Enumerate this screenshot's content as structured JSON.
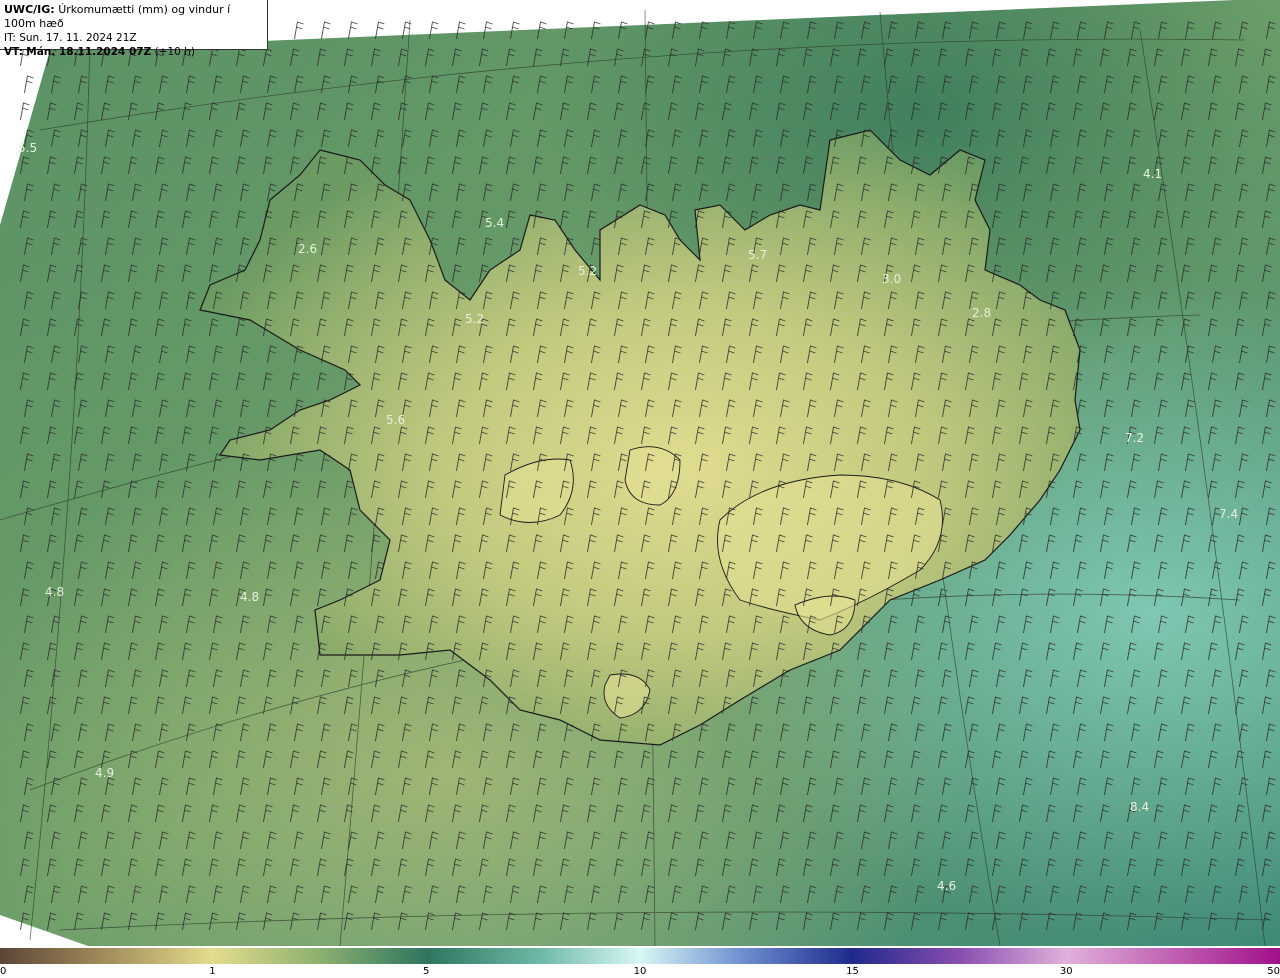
{
  "header": {
    "model": "UWC/IG:",
    "title": "Úrkomumætti (mm) og vindur í 100m hæð",
    "it": "IT: Sun. 17. 11. 2024 21Z",
    "vt_prefix": "VT:",
    "vt": "Mán. 18.11.2024 07Z",
    "vt_suffix": "(+10 h)"
  },
  "colors": {
    "sea_deep": "#2f6e5a",
    "sea_mid": "#4f8b63",
    "land_low": "#8aa96a",
    "land_high": "#d7d889",
    "coast": "#1a1a1a"
  },
  "colorbar": {
    "ticks": [
      "0",
      "1",
      "5",
      "10",
      "15",
      "30",
      "50"
    ],
    "tick_fractions": [
      0.0,
      0.166,
      0.333,
      0.5,
      0.666,
      0.833,
      1.0
    ]
  },
  "value_labels": [
    "5.5",
    "2.6",
    "5.4",
    "5.2",
    "5.7",
    "4.1",
    "3.0",
    "5.2",
    "2.8",
    "5.6",
    "7.2",
    "7.4",
    "4.8",
    "4.8",
    "4.9",
    "8.4",
    "4.6"
  ]
}
